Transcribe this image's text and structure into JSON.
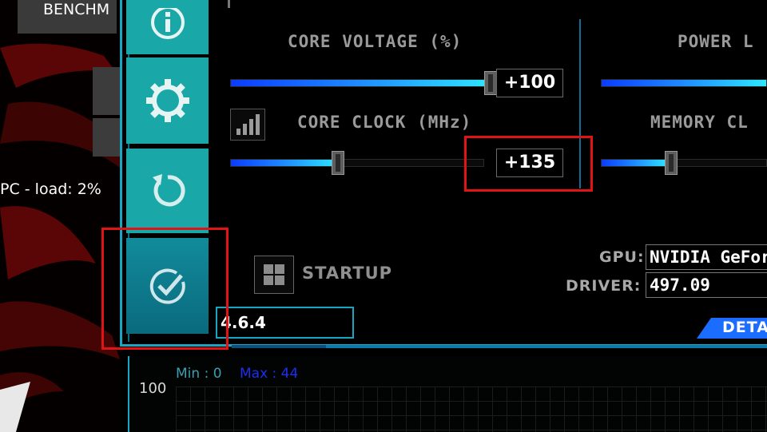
{
  "colors": {
    "accent_teal": "#1aa7a7",
    "frame_cyan": "#19a6c2",
    "highlight_red": "#e01414",
    "max_blue": "#1b2ff0",
    "details_blue": "#1b6dff"
  },
  "top_tab": {
    "label": "BENCHM"
  },
  "status": {
    "load_text": "PC - load: 2%"
  },
  "side_buttons": [
    {
      "icon": "info-icon"
    },
    {
      "icon": "gear-icon"
    },
    {
      "icon": "reset-icon"
    },
    {
      "icon": "apply-check-icon"
    }
  ],
  "core_voltage": {
    "label": "CORE VOLTAGE (%)",
    "value": "+100",
    "level": 1.0
  },
  "core_clock": {
    "label": "CORE CLOCK (MHz)",
    "value": "+135",
    "level": 0.42
  },
  "power_limit": {
    "label": "POWER L"
  },
  "memory_clock": {
    "label": "MEMORY CL"
  },
  "startup": {
    "label": "STARTUP"
  },
  "version": {
    "value": "4.6.4"
  },
  "gpu_info": {
    "gpu_label": "GPU:",
    "gpu_value": "NVIDIA GeFor",
    "driver_label": "DRIVER:",
    "driver_value": "497.09"
  },
  "details_button": {
    "label": "DETA"
  },
  "graph": {
    "min_text": "Min : 0",
    "max_text": "Max : 44",
    "y_value": "100"
  }
}
